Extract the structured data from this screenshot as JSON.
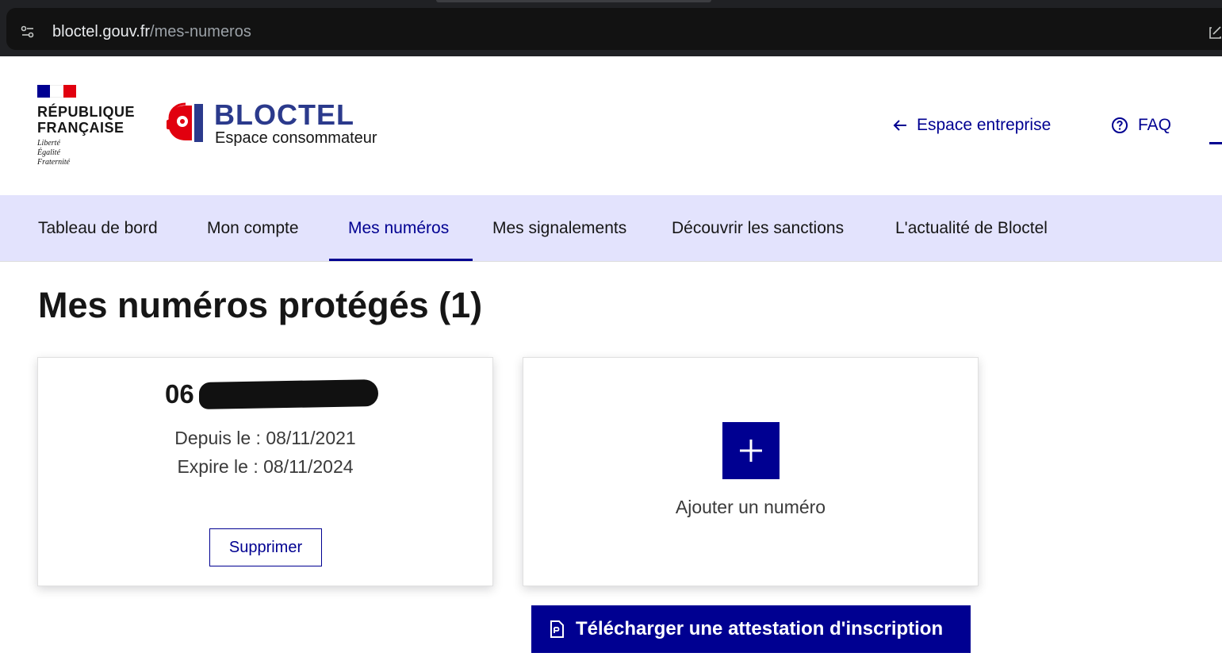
{
  "browser": {
    "url_domain": "bloctel.gouv.fr",
    "url_path": "/mes-numeros"
  },
  "header": {
    "republic_name_line1": "RÉPUBLIQUE",
    "republic_name_line2": "FRANÇAISE",
    "motto_1": "Liberté",
    "motto_2": "Égalité",
    "motto_3": "Fraternité",
    "site_title": "BLOCTEL",
    "site_subtitle": "Espace consommateur",
    "links": [
      {
        "label": "Espace entreprise",
        "icon": "arrow-left-icon"
      },
      {
        "label": "FAQ",
        "icon": "question-circle-icon"
      }
    ]
  },
  "nav": {
    "items": [
      {
        "label": "Tableau de bord"
      },
      {
        "label": "Mon compte"
      },
      {
        "label": "Mes numéros",
        "active": true
      },
      {
        "label": "Mes signalements"
      },
      {
        "label": "Découvrir les sanctions"
      },
      {
        "label": "L'actualité de Bloctel"
      }
    ]
  },
  "main": {
    "title": "Mes numéros protégés (1)",
    "number_card": {
      "number_prefix": "06",
      "since": "Depuis le : 08/11/2021",
      "expires": "Expire le : 08/11/2024",
      "delete_label": "Supprimer"
    },
    "add_card": {
      "label": "Ajouter un numéro",
      "icon": "plus-icon"
    },
    "download_button": {
      "label": "Télécharger une attestation d'inscription",
      "icon": "document-icon"
    }
  },
  "colors": {
    "primary": "#000091",
    "nav_bg": "#e3e3fd",
    "flag_blue": "#000091",
    "flag_red": "#e1000f",
    "bloctel_red": "#e1000f",
    "bloctel_blue": "#2b3a8c"
  }
}
